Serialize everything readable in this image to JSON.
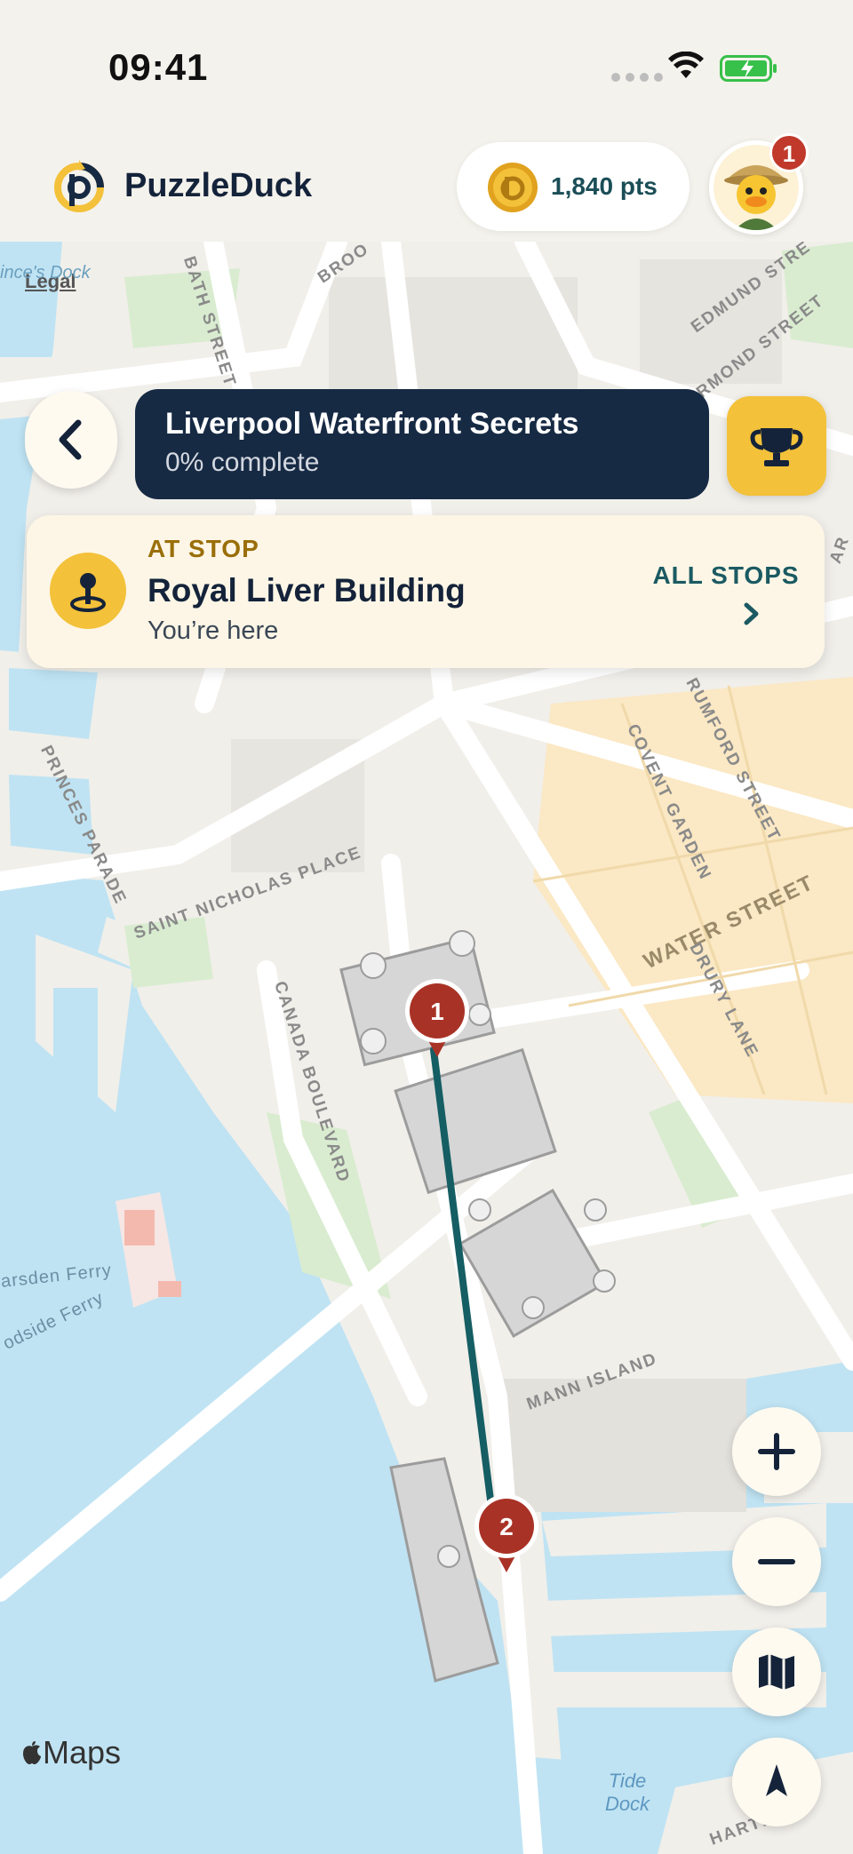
{
  "status_bar": {
    "time": "09:41"
  },
  "header": {
    "app_name": "PuzzleDuck",
    "points": "1,840 pts",
    "notification_count": "1"
  },
  "tour": {
    "title": "Liverpool Waterfront Secrets",
    "progress": "0% complete"
  },
  "stop_card": {
    "label": "AT STOP",
    "name": "Royal Liver Building",
    "subtitle": "You’re here",
    "all_stops": "ALL STOPS"
  },
  "markers": [
    {
      "number": "1"
    },
    {
      "number": "2"
    }
  ],
  "map": {
    "legal": "Legal",
    "attribution": "Maps",
    "labels": {
      "bath_street": "BATH STREET",
      "brook": "BROO",
      "edmund_street": "EDMUND STRE",
      "ormond_street": "RMOND STREET",
      "rumford_street": "RUMFORD STREET",
      "covent_garden": "COVENT GARDEN",
      "water_street": "WATER STREET",
      "drury_lane": "DRURY LANE",
      "princes_parade": "PRINCES PARADE",
      "saint_nicholas_place": "SAINT NICHOLAS PLACE",
      "canada_boulevard": "CANADA BOULEVARD",
      "mann_island": "MANN ISLAND",
      "marsden_ferry": "arsden Ferry",
      "woodside_ferry": "odside Ferry",
      "princes_dock": "ince's Dock",
      "tide_dock": "Tide Dock",
      "hartley": "HARTL     AY",
      "ar": "AR"
    }
  },
  "colors": {
    "primary_dark": "#172a44",
    "accent_yellow": "#f3c13a",
    "teal": "#1b5a62",
    "marker_red": "#a93226",
    "water": "#bfe3f3"
  },
  "icons": {
    "back": "chevron-left-icon",
    "trophy": "trophy-icon",
    "stop": "location-pin-icon",
    "zoom_in": "plus-icon",
    "zoom_out": "minus-icon",
    "map_type": "map-icon",
    "compass": "compass-icon"
  }
}
